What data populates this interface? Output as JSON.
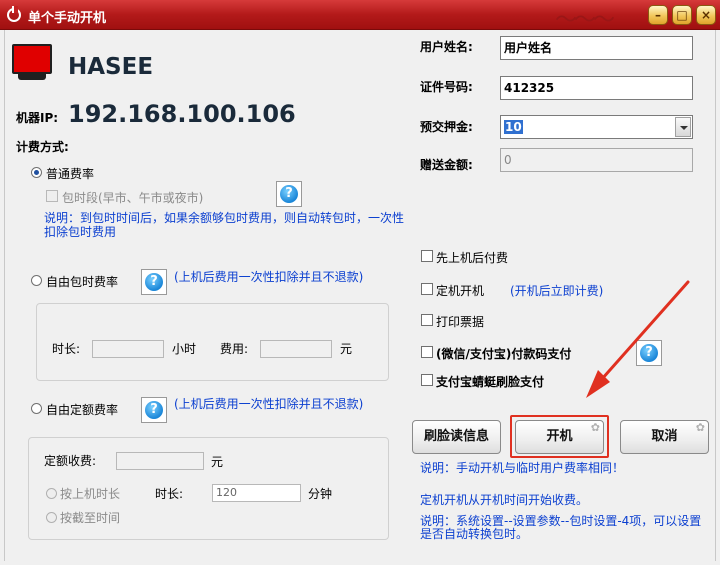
{
  "window": {
    "title": "单个手动开机",
    "min_btn": "–",
    "max_btn": "□",
    "close_btn": "×"
  },
  "colors": {
    "titlebar": "#c42222",
    "accent_blue": "#0b3fd0",
    "highlight_red": "#e03020"
  },
  "computer": {
    "brand": "HASEE",
    "ip_label": "机器IP:",
    "ip": "192.168.100.106"
  },
  "billing": {
    "section_label": "计费方式:",
    "normal_rate": "普通费率",
    "package_time": "包时段(早市、午市或夜市)",
    "normal_note": "说明：到包时时间后，如果余额够包时费用，则自动转包时，一次性扣除包时费用",
    "free_package": "自由包时费率",
    "free_package_note": "(上机后费用一次性扣除并且不退款)",
    "duration_label": "时长:",
    "hours_unit": "小时",
    "fee_label": "费用:",
    "yuan_unit": "元",
    "free_fixed": "自由定额费率",
    "free_fixed_note": "(上机后费用一次性扣除并且不退款)",
    "fixed_fee_label": "定额收费:",
    "fixed_yuan_unit": "元",
    "by_duration": "按上机时长",
    "duration2_label": "时长:",
    "duration2_value": "120",
    "minutes_unit": "分钟",
    "by_deadline": "按截至时间"
  },
  "form": {
    "username_label": "用户姓名:",
    "username_value": "用户姓名",
    "id_label": "证件号码:",
    "id_value": "412325",
    "deposit_label": "预交押金:",
    "deposit_value": "10",
    "gift_label": "赠送金额:",
    "gift_value": "0"
  },
  "options": {
    "postpaid": "先上机后付费",
    "scheduled": "定机开机",
    "scheduled_note": "(开机后立即计费)",
    "print_ticket": "打印票据",
    "wechat_alipay": "(微信/支付宝)付款码支付",
    "alipay_face": "支付宝蜻蜓刷脸支付"
  },
  "buttons": {
    "read_face": "刷脸读信息",
    "power_on": "开机",
    "cancel": "取消"
  },
  "notes": {
    "note1": "说明：手动开机与临时用户费率相同！",
    "note2": "定机开机从开机时间开始收费。",
    "note3": "说明：系统设置--设置参数--包时设置-4项，可以设置是否自动转换包时。"
  }
}
